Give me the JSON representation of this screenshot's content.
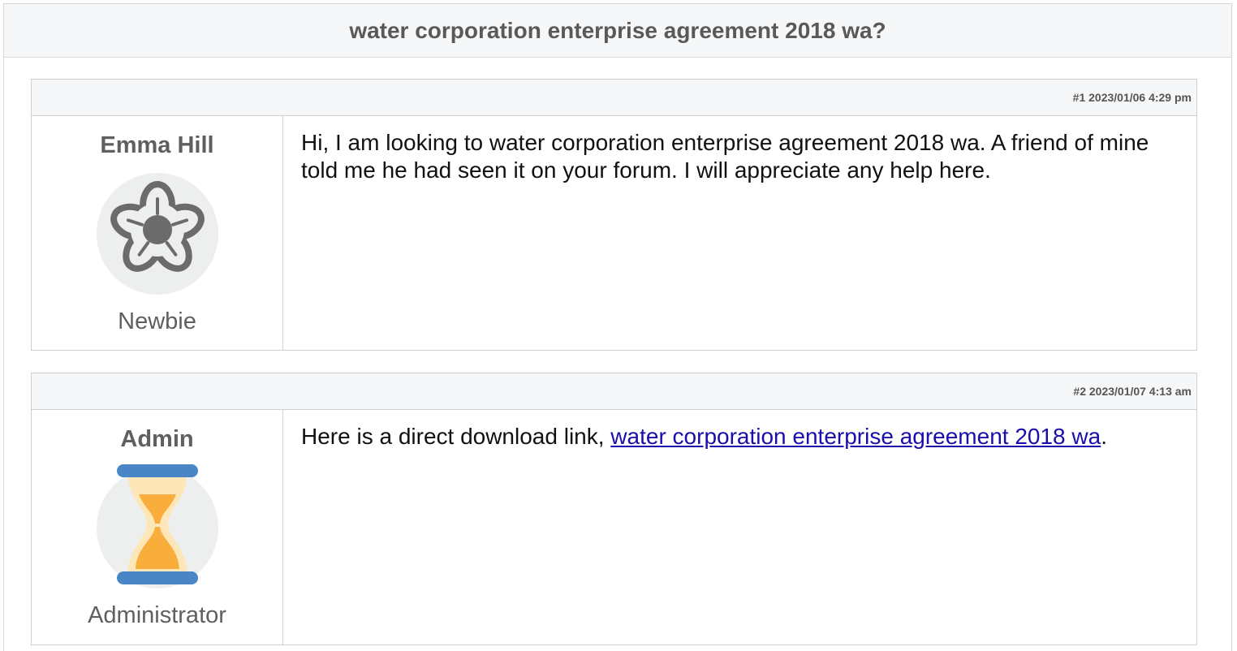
{
  "thread": {
    "title": "water corporation enterprise agreement 2018 wa?"
  },
  "posts": [
    {
      "meta": "#1 2023/01/06 4:29 pm",
      "author": "Emma Hill",
      "role": "Newbie",
      "avatar_icon": "flower-icon",
      "body": "Hi, I am looking to water corporation enterprise agreement 2018 wa. A friend of mine told me he had seen it on your forum. I will appreciate any help here."
    },
    {
      "meta": "#2 2023/01/07 4:13 am",
      "author": "Admin",
      "role": "Administrator",
      "avatar_icon": "hourglass-icon",
      "body_prefix": "Here is a direct download link, ",
      "link_text": "water corporation enterprise agreement 2018 wa",
      "body_suffix": "."
    }
  ],
  "colors": {
    "link": "#1a0dab",
    "header_bg": "#f6f7f8",
    "avatar_bg": "#edeeee",
    "hourglass_cap": "#4a86c5",
    "sand": "#f9ad3a"
  }
}
